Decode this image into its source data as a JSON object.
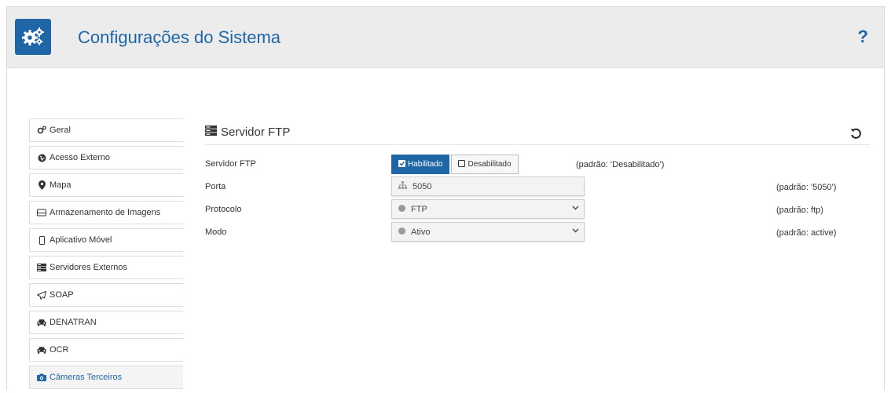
{
  "header": {
    "title": "Configurações do Sistema",
    "help": "?"
  },
  "sidebar": {
    "items": [
      {
        "label": "Geral",
        "icon": "gears-icon"
      },
      {
        "label": "Acesso Externo",
        "icon": "globe-icon"
      },
      {
        "label": "Mapa",
        "icon": "map-marker-icon"
      },
      {
        "label": "Armazenamento de Imagens",
        "icon": "hdd-icon"
      },
      {
        "label": "Aplicativo Móvel",
        "icon": "mobile-icon"
      },
      {
        "label": "Servidores Externos",
        "icon": "server-icon"
      },
      {
        "label": "SOAP",
        "icon": "paper-plane-icon"
      },
      {
        "label": "DENATRAN",
        "icon": "car-icon"
      },
      {
        "label": "OCR",
        "icon": "car-icon"
      },
      {
        "label": "Câmeras Terceiros",
        "icon": "camera-icon"
      }
    ],
    "active_index": 9
  },
  "section": {
    "title": "Servidor FTP",
    "rows": {
      "servidor": {
        "label": "Servidor FTP",
        "on_label": "Habilitado",
        "off_label": "Desabilitado",
        "default": "(padrão: 'Desabilitado')"
      },
      "porta": {
        "label": "Porta",
        "value": "5050",
        "default": "(padrão: '5050')"
      },
      "protocolo": {
        "label": "Protocolo",
        "value": "FTP",
        "default": "(padrão: ftp)"
      },
      "modo": {
        "label": "Modo",
        "value": "Ativo",
        "default": "(padrão: active)"
      }
    }
  },
  "colors": {
    "accent": "#1f66a6",
    "header_bg": "#ececec"
  }
}
